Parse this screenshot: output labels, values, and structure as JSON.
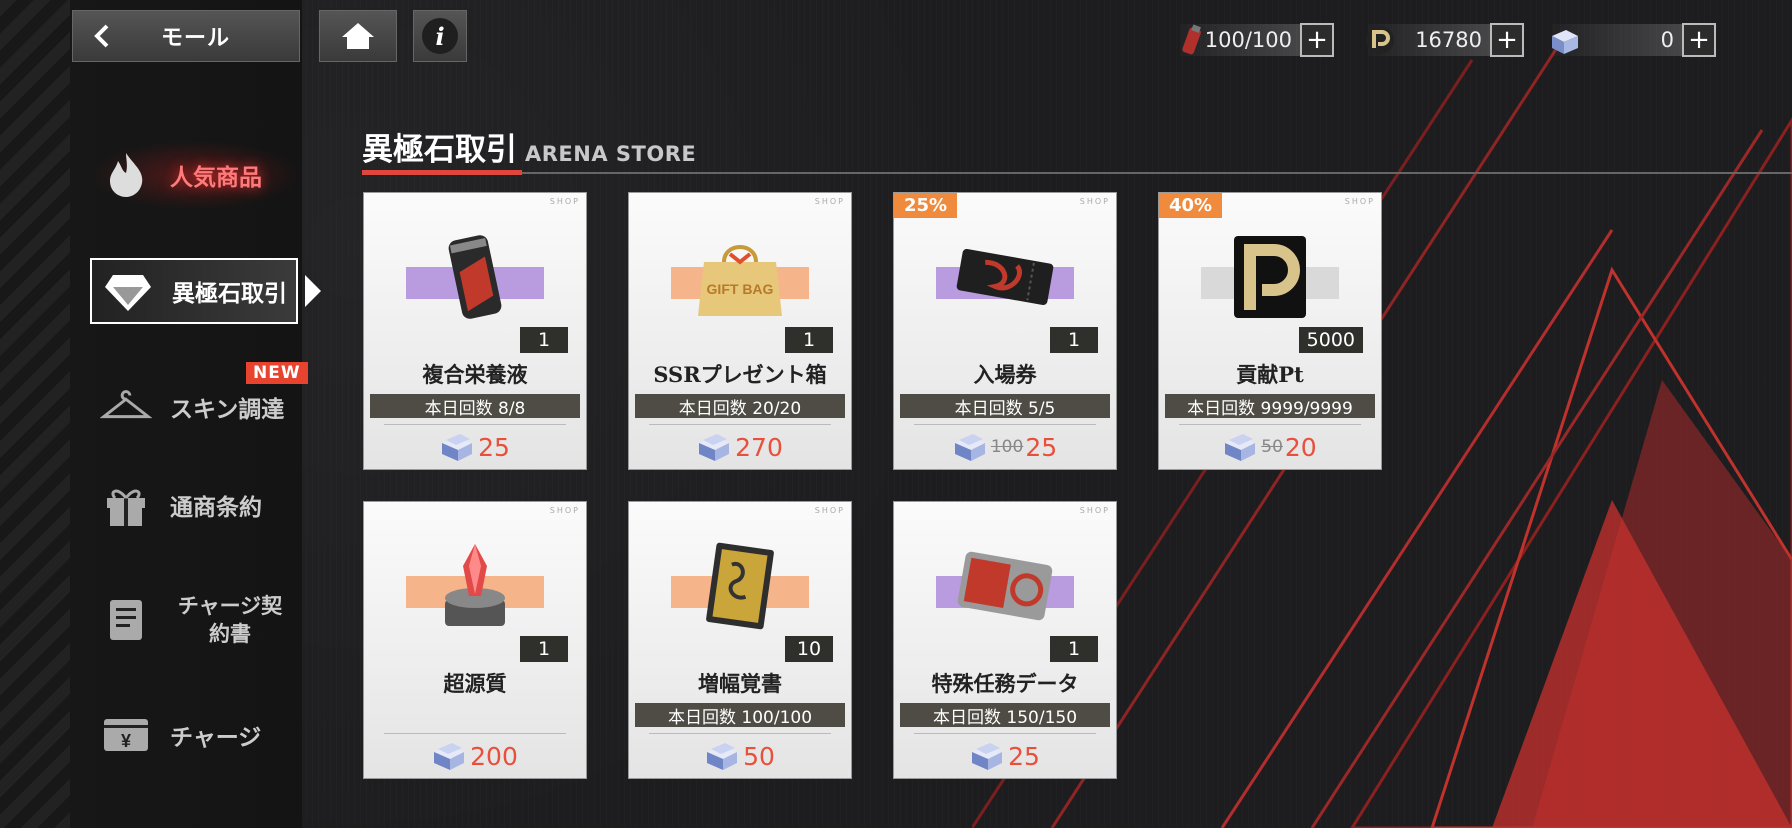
{
  "header": {
    "back_label": "モール",
    "resources": [
      {
        "icon": "energy-canister-icon",
        "value": "100/100"
      },
      {
        "icon": "contribution-pt-icon",
        "value": "16780"
      },
      {
        "icon": "special-stone-icon",
        "value": "0"
      }
    ]
  },
  "sidebar": {
    "items": [
      {
        "label": "人気商品",
        "icon": "flame-icon"
      },
      {
        "label": "異極石取引",
        "icon": "diamond-icon"
      },
      {
        "label": "スキン調達",
        "icon": "hanger-icon",
        "badge": "NEW"
      },
      {
        "label": "通商条約",
        "icon": "gift-icon"
      },
      {
        "label": "チャージ契約書",
        "icon": "document-icon"
      },
      {
        "label": "チャージ",
        "icon": "yen-wallet-icon"
      }
    ]
  },
  "store": {
    "title_jp": "異極石取引",
    "title_en": "ARENA STORE"
  },
  "cards": [
    {
      "name": "複合栄養液",
      "qty": "1",
      "limit": "本日回数 8/8",
      "price": "25",
      "old_price": "",
      "discount": "",
      "band": "#b99be0",
      "icon": "canned-drink-icon"
    },
    {
      "name": "SSRプレゼント箱",
      "qty": "1",
      "limit": "本日回数 20/20",
      "price": "270",
      "old_price": "",
      "discount": "",
      "band": "#f5b48a",
      "icon": "gift-bag-icon"
    },
    {
      "name": "入場券",
      "qty": "1",
      "limit": "本日回数 5/5",
      "price": "25",
      "old_price": "100",
      "discount": "25%",
      "band": "#b99be0",
      "icon": "ticket-icon"
    },
    {
      "name": "貢献Pt",
      "qty": "5000",
      "limit": "本日回数 9999/9999",
      "price": "20",
      "old_price": "50",
      "discount": "40%",
      "band": "#d9d9d9",
      "icon": "contribution-pt-icon"
    },
    {
      "name": "超源質",
      "qty": "1",
      "limit": "",
      "price": "200",
      "old_price": "",
      "discount": "",
      "band": "#f5b48a",
      "icon": "crystal-device-icon"
    },
    {
      "name": "増幅覚書",
      "qty": "10",
      "limit": "本日回数 100/100",
      "price": "50",
      "old_price": "",
      "discount": "",
      "band": "#f5b48a",
      "icon": "memo-book-icon"
    },
    {
      "name": "特殊任務データ",
      "qty": "1",
      "limit": "本日回数 150/150",
      "price": "25",
      "old_price": "",
      "discount": "",
      "band": "#b99be0",
      "icon": "data-chip-icon"
    }
  ],
  "colors": {
    "accent_red": "#e0473c",
    "price_red": "#e9503c",
    "discount_orange": "#f08a3c"
  }
}
